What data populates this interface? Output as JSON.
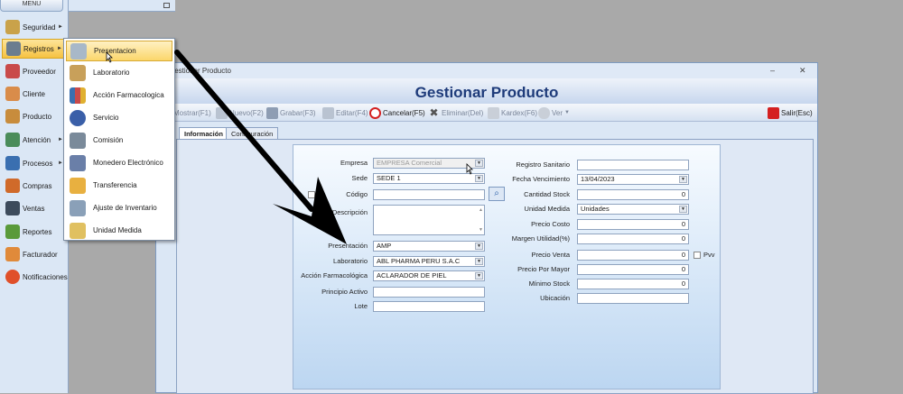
{
  "menu": {
    "header": "MENU"
  },
  "sidebar": {
    "items": [
      {
        "label": "Seguridad",
        "icon": "lock-icon"
      },
      {
        "label": "Registros",
        "icon": "registry-icon"
      },
      {
        "label": "Proveedor",
        "icon": "supplier-icon"
      },
      {
        "label": "Cliente",
        "icon": "client-icon"
      },
      {
        "label": "Producto",
        "icon": "box-icon"
      },
      {
        "label": "Atención",
        "icon": "attention-icon"
      },
      {
        "label": "Procesos",
        "icon": "process-icon"
      },
      {
        "label": "Compras",
        "icon": "shopping-bag-icon"
      },
      {
        "label": "Ventas",
        "icon": "cash-register-icon"
      },
      {
        "label": "Reportes",
        "icon": "chart-icon"
      },
      {
        "label": "Facturador",
        "icon": "invoice-icon"
      },
      {
        "label": "Notificaciones",
        "icon": "notification-icon"
      }
    ]
  },
  "submenu": {
    "items": [
      {
        "label": "Presentacion",
        "icon": "presentation-icon"
      },
      {
        "label": "Laboratorio",
        "icon": "laboratory-icon"
      },
      {
        "label": "Acción Farmacologica",
        "icon": "books-icon"
      },
      {
        "label": "Servicio",
        "icon": "service-icon"
      },
      {
        "label": "Comisión",
        "icon": "commission-icon"
      },
      {
        "label": "Monedero Electrónico",
        "icon": "wallet-icon"
      },
      {
        "label": "Transferencia",
        "icon": "transfer-icon"
      },
      {
        "label": "Ajuste de Inventario",
        "icon": "inventory-icon"
      },
      {
        "label": "Unidad Medida",
        "icon": "ruler-icon"
      }
    ]
  },
  "window": {
    "title": "Gestionar Producto",
    "form_title": "Gestionar Producto"
  },
  "toolbar": {
    "mostrar": "Mostrar(F1)",
    "nuevo": "Nuevo(F2)",
    "grabar": "Grabar(F3)",
    "editar": "Editar(F4)",
    "cancelar": "Cancelar(F5)",
    "eliminar": "Eliminar(Del)",
    "kardex": "Kardex(F6)",
    "ver": "Ver",
    "salir": "Salir(Esc)"
  },
  "tabs": [
    "Información",
    "Configuración"
  ],
  "form": {
    "empresa": {
      "label": "Empresa",
      "value": "EMPRESA Comercial"
    },
    "sede": {
      "label": "Sede",
      "value": "SEDE 1"
    },
    "codigo": {
      "label": "Código",
      "value": ""
    },
    "descripcion": {
      "label": "Descripción",
      "value": ""
    },
    "presentacion": {
      "label": "Presentación",
      "value": "AMP"
    },
    "laboratorio": {
      "label": "Laboratorio",
      "value": "ABL PHARMA PERU S.A.C"
    },
    "accion": {
      "label": "Acción Farmacológica",
      "value": "ACLARADOR DE PIEL"
    },
    "principio": {
      "label": "Principio Activo",
      "value": ""
    },
    "lote": {
      "label": "Lote",
      "value": ""
    },
    "registro_sanitario": {
      "label": "Registro Sanitario",
      "value": ""
    },
    "fecha_vencimiento": {
      "label": "Fecha Vencimiento",
      "value": "13/04/2023"
    },
    "cantidad_stock": {
      "label": "Cantidad Stock",
      "value": "0"
    },
    "unidad_medida": {
      "label": "Unidad Medida",
      "value": "Unidades"
    },
    "precio_costo": {
      "label": "Precio Costo",
      "value": "0"
    },
    "margen": {
      "label": "Margen Utilidad(%)",
      "value": "0"
    },
    "precio_venta": {
      "label": "Precio Venta",
      "value": "0"
    },
    "pvv": {
      "label": "Pvv"
    },
    "precio_mayor": {
      "label": "Precio Por Mayor",
      "value": "0"
    },
    "minimo_stock": {
      "label": "Mínimo Stock",
      "value": "0"
    },
    "ubicacion": {
      "label": "Ubicación",
      "value": ""
    }
  }
}
